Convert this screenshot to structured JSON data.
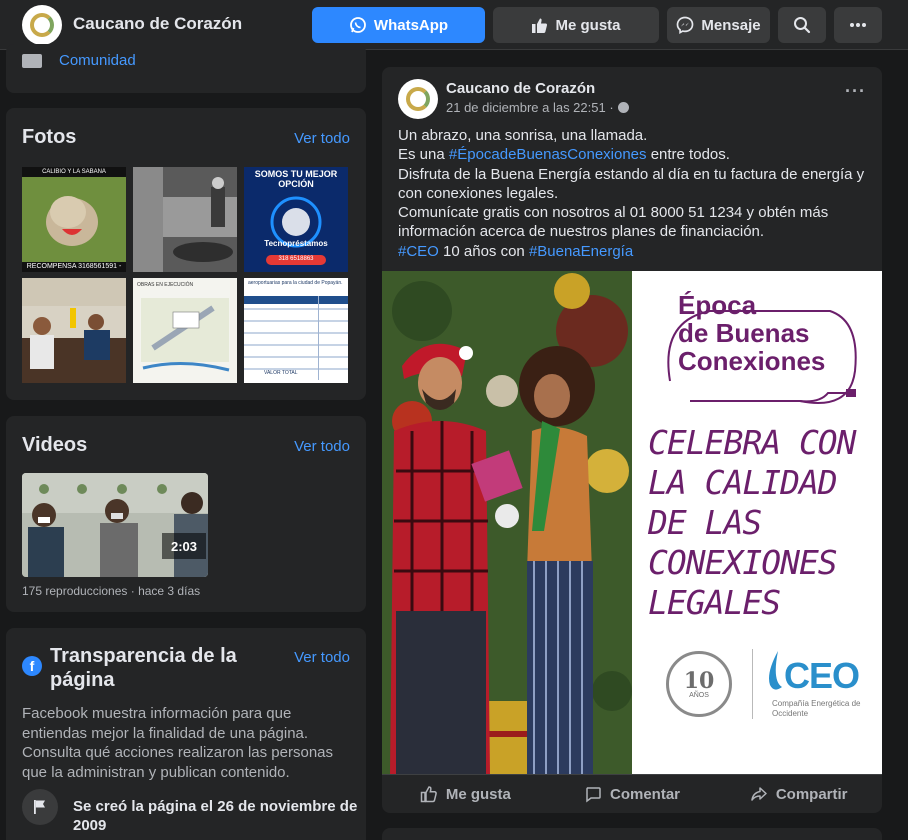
{
  "header": {
    "page_name": "Caucano de Corazón",
    "whatsapp_label": "WhatsApp",
    "like_label": "Me gusta",
    "message_label": "Mensaje"
  },
  "sidebar": {
    "community_label": "Comunidad",
    "photos": {
      "title": "Fotos",
      "see_all": "Ver todo",
      "items": [
        {
          "caption_top": "CALIBIO Y LA SABANA",
          "caption_bottom": "RECOMPENSA 3168561591 -"
        },
        {
          "caption_top": "",
          "caption_bottom": ""
        },
        {
          "caption_top": "SOMOS TU MEJOR OPCIÓN",
          "caption_mid": "Tecnopréstamos",
          "caption_bottom": "318 6518863"
        },
        {
          "caption_top": "",
          "caption_bottom": ""
        },
        {
          "caption_top": "OBRAS EN EJECUCIÓN",
          "caption_bottom": ""
        },
        {
          "caption_top": "aeroportuarias para la ciudad de Popayán.",
          "caption_bottom": "VALOR TOTAL"
        }
      ]
    },
    "videos": {
      "title": "Videos",
      "see_all": "Ver todo",
      "duration": "2:03",
      "meta": "175 reproducciones · hace 3 días"
    },
    "transparency": {
      "title": "Transparencia de la página",
      "see_all": "Ver todo",
      "body": "Facebook muestra información para que entiendas mejor la finalidad de una página. Consulta qué acciones realizaron las personas que la administran y publican contenido.",
      "created": "Se creó la página el 26 de noviembre de 2009"
    }
  },
  "post": {
    "author": "Caucano de Corazón",
    "date": "21 de diciembre a las 22:51 ·",
    "lines": {
      "l1": "Un abrazo, una sonrisa, una llamada.",
      "l2_pre": "Es una ",
      "l2_tag": "#ÉpocadeBuenasConexiones",
      "l2_post": " entre todos.",
      "l3": "Disfruta de la Buena Energía estando al día en tu factura de energía y",
      "l4": "con conexiones legales.",
      "l5": "Comunícate gratis con nosotros al 01 8000 51 1234 y obtén más",
      "l6": "información acerca de nuestros planes de financiación.",
      "l7_tag1": "#CEO",
      "l7_mid": " 10 años con ",
      "l7_tag2": "#BuenaEnergía"
    },
    "image": {
      "banner_line1": "Época",
      "banner_line2": "de Buenas",
      "banner_line3": "Conexiones",
      "slogan": [
        "CELEBRA CON",
        "LA CALIDAD",
        "DE LAS",
        "CONEXIONES",
        "LEGALES"
      ],
      "logo_number": "10",
      "logo_years": "AÑOS",
      "ceo": "CEO",
      "ceo_sub": "Compañía Energética de Occidente"
    },
    "actions": {
      "like": "Me gusta",
      "comment": "Comentar",
      "share": "Compartir"
    }
  },
  "colors": {
    "background": "#18191a",
    "card": "#242526",
    "link": "#4599ff",
    "whatsapp_button": "#2d88ff",
    "slogan": "#6b1f6b"
  }
}
